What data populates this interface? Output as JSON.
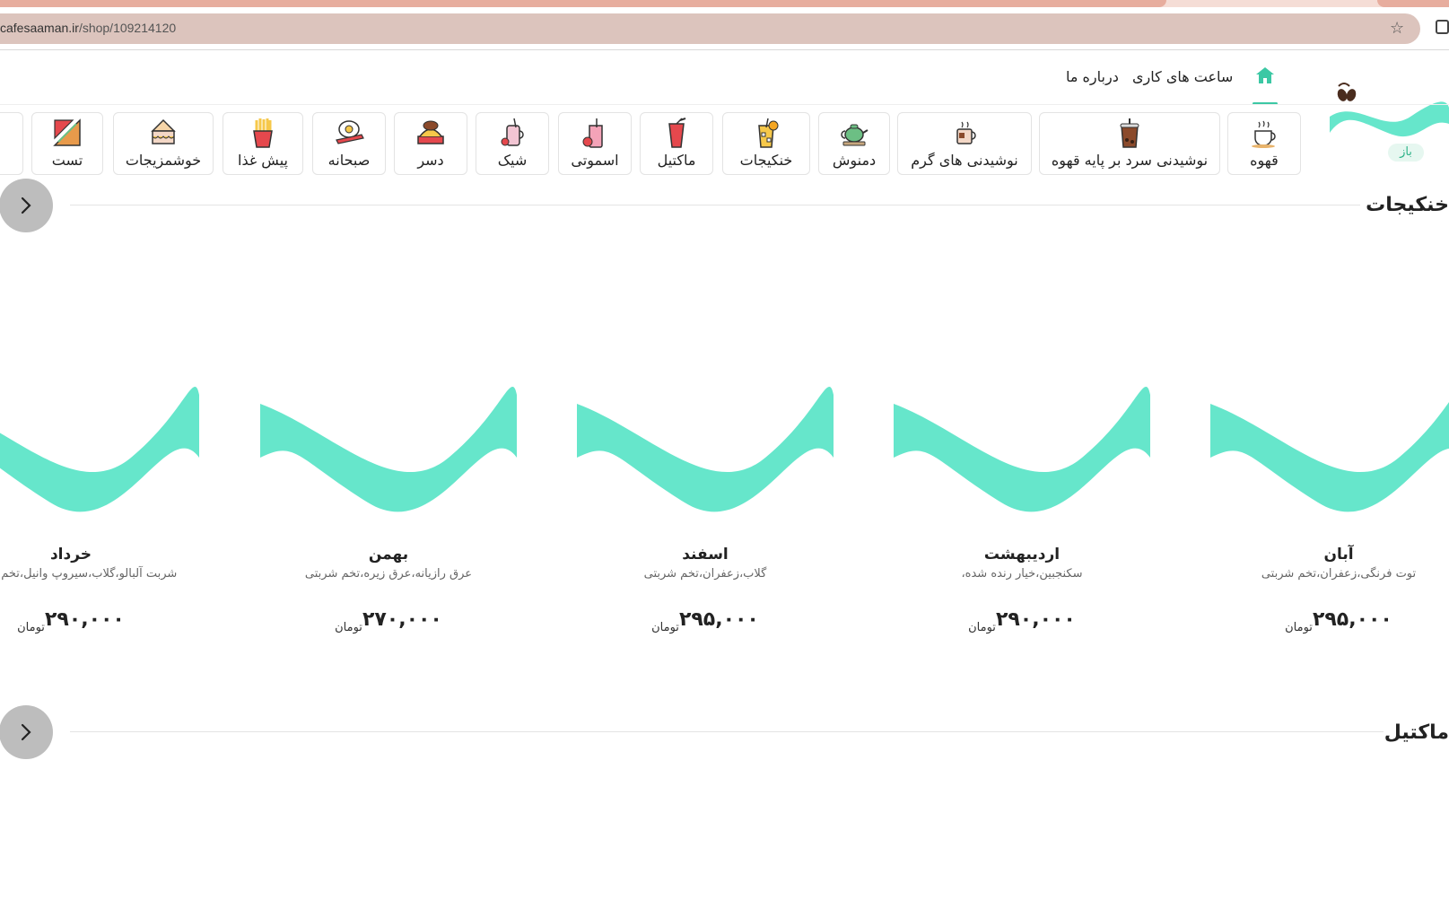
{
  "browser": {
    "url_host": "cafesaaman.ir",
    "url_path": "/shop/109214120"
  },
  "brand": {
    "status_badge": "باز",
    "accent_color": "#66e6cb"
  },
  "topnav": {
    "hours_label": "ساعت های کاری",
    "about_label": "درباره ما"
  },
  "categories": [
    {
      "label": "قهوه",
      "icon": "coffee-cup-icon"
    },
    {
      "label": "نوشیدنی سرد بر پایه قهوه",
      "icon": "iced-coffee-icon"
    },
    {
      "label": "نوشیدنی های گرم",
      "icon": "hot-drink-icon"
    },
    {
      "label": "دمنوش",
      "icon": "teapot-icon"
    },
    {
      "label": "خنکیجات",
      "icon": "lemonade-icon"
    },
    {
      "label": "ماکتیل",
      "icon": "mocktail-icon"
    },
    {
      "label": "اسموتی",
      "icon": "smoothie-icon"
    },
    {
      "label": "شیک",
      "icon": "shake-icon"
    },
    {
      "label": "دسر",
      "icon": "dessert-icon"
    },
    {
      "label": "صبحانه",
      "icon": "breakfast-icon"
    },
    {
      "label": "پیش غذا",
      "icon": "fries-icon"
    },
    {
      "label": "خوشمزیجات",
      "icon": "cake-icon"
    },
    {
      "label": "تست",
      "icon": "sandwich-icon"
    }
  ],
  "sections": [
    {
      "title": "خنکیجات"
    },
    {
      "title": "ماکتیل"
    }
  ],
  "products": [
    {
      "name": "آبان",
      "desc": "توت فرنگی،زعفران،تخم شربتی",
      "price": "۲۹۵,۰۰۰",
      "currency": "تومان"
    },
    {
      "name": "اردیبهشت",
      "desc": "سکنجبین،خیار رنده شده،",
      "price": "۲۹۰,۰۰۰",
      "currency": "تومان"
    },
    {
      "name": "اسفند",
      "desc": "گلاب،زعفران،تخم شربتی",
      "price": "۲۹۵,۰۰۰",
      "currency": "تومان"
    },
    {
      "name": "بهمن",
      "desc": "عرق رازیانه،عرق زیره،تخم شربتی",
      "price": "۲۷۰,۰۰۰",
      "currency": "تومان"
    },
    {
      "name": "خرداد",
      "desc": "شربت آلبالو،گلاب،سیروپ وانیل،تخم شربتی",
      "price": "۲۹۰,۰۰۰",
      "currency": "تومان"
    }
  ]
}
